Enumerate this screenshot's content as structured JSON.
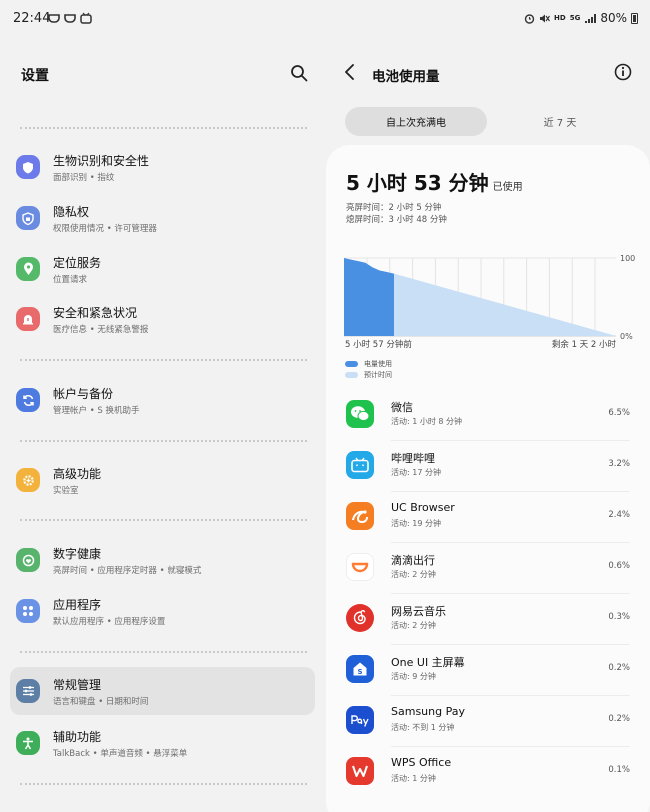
{
  "status": {
    "time": "22:44",
    "net_hd": "HD",
    "net_5g": "5G",
    "battery": "80%"
  },
  "left": {
    "title": "设置",
    "items": [
      {
        "title": "生物识别和安全性",
        "sub": "面部识别 • 指纹",
        "icon": "shield-icon",
        "color": "#6c7be9"
      },
      {
        "title": "隐私权",
        "sub": "权限使用情况 • 许可管理器",
        "icon": "privacy-shield-icon",
        "color": "#6a8ce0"
      },
      {
        "title": "定位服务",
        "sub": "位置请求",
        "icon": "location-pin-icon",
        "color": "#55b96a"
      },
      {
        "title": "安全和紧急状况",
        "sub": "医疗信息 • 无线紧急警报",
        "icon": "emergency-icon",
        "color": "#e96a6a"
      },
      {
        "title": "帐户与备份",
        "sub": "管理帐户 • S 换机助手",
        "icon": "sync-icon",
        "color": "#4e7bdf"
      },
      {
        "title": "高级功能",
        "sub": "实验室",
        "icon": "gear-plus-icon",
        "color": "#f2b23c"
      },
      {
        "title": "数字健康",
        "sub": "亮屏时间 • 应用程序定时器 • 就寝模式",
        "icon": "wellbeing-icon",
        "color": "#58b36c"
      },
      {
        "title": "应用程序",
        "sub": "默认应用程序 • 应用程序设置",
        "icon": "apps-grid-icon",
        "color": "#6a93e6"
      },
      {
        "title": "常规管理",
        "sub": "语言和键盘 • 日期和时间",
        "icon": "sliders-icon",
        "color": "#5d7fa6"
      },
      {
        "title": "辅助功能",
        "sub": "TalkBack • 单声道音频 • 悬浮菜单",
        "icon": "accessibility-icon",
        "color": "#3fae5a"
      }
    ]
  },
  "right": {
    "title": "电池使用量",
    "tab_active": "自上次充满电",
    "tab_other": "近 7 天",
    "total": "5 小时 53 分钟",
    "total_suffix": "已使用",
    "screen_on": "亮屏时间：2 小时 5 分钟",
    "screen_off": "熄屏时间：3 小时 48 分钟",
    "chart_left_label": "5 小时 57 分钟前",
    "chart_right_label": "剩余 1 天 2 小时",
    "legend_used": "电量使用",
    "legend_predicted": "预计时间",
    "apps": [
      {
        "name": "微信",
        "active": "活动: 1 小时 8 分钟",
        "pct": "6.5%",
        "icon": "wechat-icon",
        "color": "#1fc24d"
      },
      {
        "name": "哔哩哔哩",
        "active": "活动: 17 分钟",
        "pct": "3.2%",
        "icon": "bilibili-icon",
        "color": "#23a8e8"
      },
      {
        "name": "UC Browser",
        "active": "活动: 19 分钟",
        "pct": "2.4%",
        "icon": "uc-browser-icon",
        "color": "#f57e22"
      },
      {
        "name": "滴滴出行",
        "active": "活动: 2 分钟",
        "pct": "0.6%",
        "icon": "didi-icon",
        "color": "#ff7a33"
      },
      {
        "name": "网易云音乐",
        "active": "活动: 2 分钟",
        "pct": "0.3%",
        "icon": "netease-music-icon",
        "color": "#e0312a"
      },
      {
        "name": "One UI 主屏幕",
        "active": "活动: 9 分钟",
        "pct": "0.2%",
        "icon": "oneui-home-icon",
        "color": "#1f5fd8"
      },
      {
        "name": "Samsung Pay",
        "active": "活动: 不到 1 分钟",
        "pct": "0.2%",
        "icon": "samsung-pay-icon",
        "color": "#1c4fcf"
      },
      {
        "name": "WPS Office",
        "active": "活动: 1 分钟",
        "pct": "0.1%",
        "icon": "wps-office-icon",
        "color": "#e5392e"
      }
    ]
  },
  "chart_data": {
    "type": "area",
    "yticks": [
      "100",
      "0%"
    ],
    "series": [
      {
        "name": "电量使用",
        "values": [
          100,
          98,
          96,
          94,
          88,
          84,
          82,
          80
        ],
        "color": "#4a90e2"
      },
      {
        "name": "预计时间",
        "values": [
          80,
          0
        ],
        "color": "#c8dff5"
      }
    ],
    "ylim": [
      0,
      100
    ]
  }
}
